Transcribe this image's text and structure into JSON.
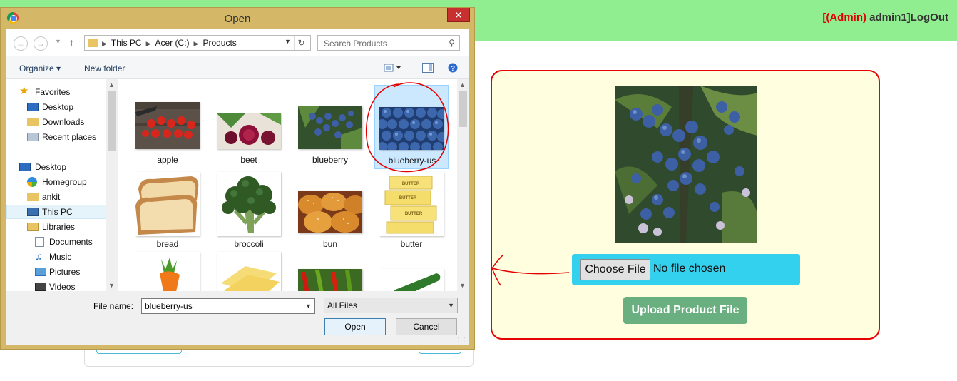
{
  "header": {
    "bracket_open": "[",
    "role": "(Admin)",
    "username": " admin1",
    "bracket_close": "]",
    "logout_label": "LogOut"
  },
  "upload": {
    "choose_label": "Choose File",
    "no_file_text": "No file chosen",
    "upload_label": "Upload Product File"
  },
  "dialog": {
    "title": "Open",
    "close_symbol": "✕",
    "breadcrumbs": [
      "This PC",
      "Acer (C:)",
      "Products"
    ],
    "search_placeholder": "Search Products",
    "organize_label": "Organize ▾",
    "new_folder_label": "New folder",
    "nav": {
      "favorites": "Favorites",
      "desktop_fav": "Desktop",
      "downloads": "Downloads",
      "recent": "Recent places",
      "desktop": "Desktop",
      "homegroup": "Homegroup",
      "ankit": "ankit",
      "this_pc": "This PC",
      "libraries": "Libraries",
      "documents": "Documents",
      "music": "Music",
      "pictures": "Pictures",
      "videos": "Videos"
    },
    "files": [
      "apple",
      "beet",
      "blueberry",
      "blueberry-us",
      "bread",
      "broccoli",
      "bun",
      "butter"
    ],
    "selected_file": "blueberry-us",
    "file_name_label": "File name:",
    "file_name_value": "blueberry-us",
    "filter_value": "All Files",
    "open_label": "Open",
    "cancel_label": "Cancel"
  }
}
